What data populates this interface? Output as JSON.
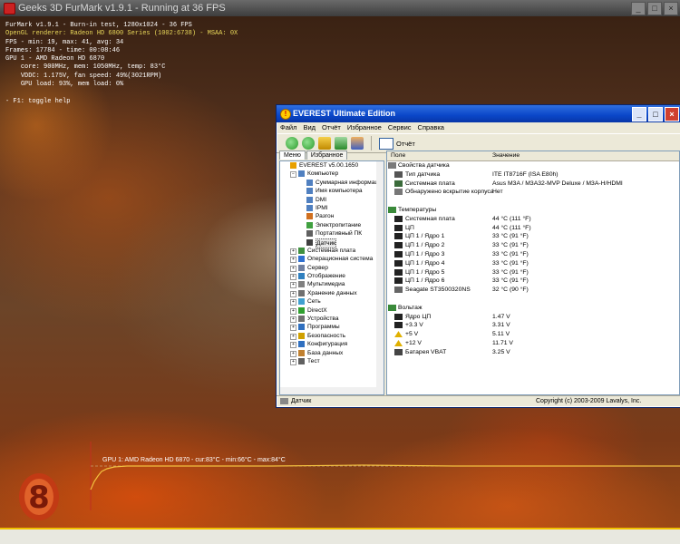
{
  "furmark": {
    "window_title": "Geeks 3D FurMark v1.9.1 - Running at 36 FPS",
    "osd": {
      "line1": "FurMark v1.9.1 - Burn-in test, 1280x1024 - 36 FPS",
      "line2": "OpenGL renderer: Radeon HD 6800 Series (1002:6738) - MSAA: 0X",
      "line3": "FPS - min: 19, max: 41, avg: 34",
      "line4": "Frames: 17784 - time: 00:08:46",
      "line5": "GPU 1 - AMD Radeon HD 6870",
      "line6": "core: 900MHz, mem: 1050MHz, temp: 83°C",
      "line7": "VDDC: 1.175V, fan speed: 49%(3021RPM)",
      "line8": "GPU load: 93%, mem load: 0%",
      "line9": "- F1: toggle help"
    },
    "graph_label": "GPU 1: AMD Radeon HD 6870 - cur:83°C - min:66°C - max:84°C",
    "logo_char": "8"
  },
  "everest": {
    "window_title": "EVEREST Ultimate Edition",
    "menu": [
      "Файл",
      "Вид",
      "Отчёт",
      "Избранное",
      "Сервис",
      "Справка"
    ],
    "report_label": "Отчёт",
    "tabs": [
      "Меню",
      "Избранное"
    ],
    "tree": [
      {
        "label": "EVEREST v5.00.1650",
        "depth": 0,
        "pm": "",
        "icon": "everest-icon",
        "color": "#e8a000"
      },
      {
        "label": "Компьютер",
        "depth": 1,
        "pm": "−",
        "icon": "computer-icon",
        "color": "#5080c0"
      },
      {
        "label": "Суммарная информация",
        "depth": 2,
        "pm": "",
        "icon": "summary-icon",
        "color": "#5080c0"
      },
      {
        "label": "Имя компьютера",
        "depth": 2,
        "pm": "",
        "icon": "computer-name-icon",
        "color": "#5080c0"
      },
      {
        "label": "DMI",
        "depth": 2,
        "pm": "",
        "icon": "dmi-icon",
        "color": "#5080c0"
      },
      {
        "label": "IPMI",
        "depth": 2,
        "pm": "",
        "icon": "ipmi-icon",
        "color": "#5080c0"
      },
      {
        "label": "Разгон",
        "depth": 2,
        "pm": "",
        "icon": "overclock-icon",
        "color": "#d07020"
      },
      {
        "label": "Электропитание",
        "depth": 2,
        "pm": "",
        "icon": "power-icon",
        "color": "#40a040"
      },
      {
        "label": "Портативный ПК",
        "depth": 2,
        "pm": "",
        "icon": "laptop-icon",
        "color": "#606060"
      },
      {
        "label": "Датчик",
        "depth": 2,
        "pm": "",
        "icon": "sensor-icon",
        "color": "#404040",
        "selected": true
      },
      {
        "label": "Системная плата",
        "depth": 1,
        "pm": "+",
        "icon": "motherboard-icon",
        "color": "#409040"
      },
      {
        "label": "Операционная система",
        "depth": 1,
        "pm": "+",
        "icon": "os-icon",
        "color": "#3070d0"
      },
      {
        "label": "Сервер",
        "depth": 1,
        "pm": "+",
        "icon": "server-icon",
        "color": "#7080a0"
      },
      {
        "label": "Отображение",
        "depth": 1,
        "pm": "+",
        "icon": "display-icon",
        "color": "#3080c0"
      },
      {
        "label": "Мультимедиа",
        "depth": 1,
        "pm": "+",
        "icon": "multimedia-icon",
        "color": "#808080"
      },
      {
        "label": "Хранение данных",
        "depth": 1,
        "pm": "+",
        "icon": "storage-icon",
        "color": "#707070"
      },
      {
        "label": "Сеть",
        "depth": 1,
        "pm": "+",
        "icon": "network-icon",
        "color": "#40a0d0"
      },
      {
        "label": "DirectX",
        "depth": 1,
        "pm": "+",
        "icon": "directx-icon",
        "color": "#30a030"
      },
      {
        "label": "Устройства",
        "depth": 1,
        "pm": "+",
        "icon": "devices-icon",
        "color": "#707070"
      },
      {
        "label": "Программы",
        "depth": 1,
        "pm": "+",
        "icon": "programs-icon",
        "color": "#3070c0"
      },
      {
        "label": "Безопасность",
        "depth": 1,
        "pm": "+",
        "icon": "security-icon",
        "color": "#d0a000"
      },
      {
        "label": "Конфигурация",
        "depth": 1,
        "pm": "+",
        "icon": "config-icon",
        "color": "#3070c0"
      },
      {
        "label": "База данных",
        "depth": 1,
        "pm": "+",
        "icon": "database-icon",
        "color": "#c08030"
      },
      {
        "label": "Тест",
        "depth": 1,
        "pm": "+",
        "icon": "test-icon",
        "color": "#606060"
      }
    ],
    "columns": {
      "field": "Поле",
      "value": "Значение"
    },
    "rows": [
      {
        "type": "section",
        "field": "Свойства датчика",
        "value": "",
        "icon": "sensor-properties-icon"
      },
      {
        "type": "item",
        "field": "Тип датчика",
        "value": "ITE IT8716F  (ISA E80h)",
        "icon": "chip-icon"
      },
      {
        "type": "item",
        "field": "Системная плата",
        "value": "Asus M3A / M3A32-MVP Deluxe / M3A-H/HDMI",
        "icon": "board-icon"
      },
      {
        "type": "item",
        "field": "Обнаружено вскрытие корпуса",
        "value": "Нет",
        "icon": "case-icon"
      },
      {
        "type": "blank",
        "field": "",
        "value": "",
        "icon": ""
      },
      {
        "type": "section",
        "field": "Температуры",
        "value": "",
        "icon": "thermometer-icon"
      },
      {
        "type": "item",
        "field": "Системная плата",
        "value": "44 °C  (111 °F)",
        "icon": "temp-sensor-icon"
      },
      {
        "type": "item",
        "field": "ЦП",
        "value": "44 °C  (111 °F)",
        "icon": "temp-sensor-icon"
      },
      {
        "type": "item",
        "field": "ЦП 1 / Ядро 1",
        "value": "33 °C  (91 °F)",
        "icon": "temp-sensor-icon"
      },
      {
        "type": "item",
        "field": "ЦП 1 / Ядро 2",
        "value": "33 °C  (91 °F)",
        "icon": "temp-sensor-icon"
      },
      {
        "type": "item",
        "field": "ЦП 1 / Ядро 3",
        "value": "33 °C  (91 °F)",
        "icon": "temp-sensor-icon"
      },
      {
        "type": "item",
        "field": "ЦП 1 / Ядро 4",
        "value": "33 °C  (91 °F)",
        "icon": "temp-sensor-icon"
      },
      {
        "type": "item",
        "field": "ЦП 1 / Ядро 5",
        "value": "33 °C  (91 °F)",
        "icon": "temp-sensor-icon"
      },
      {
        "type": "item",
        "field": "ЦП 1 / Ядро 6",
        "value": "33 °C  (91 °F)",
        "icon": "temp-sensor-icon"
      },
      {
        "type": "item",
        "field": "Seagate ST3500320NS",
        "value": "32 °C  (90 °F)",
        "icon": "hdd-icon"
      },
      {
        "type": "blank",
        "field": "",
        "value": "",
        "icon": ""
      },
      {
        "type": "section",
        "field": "Вольтаж",
        "value": "",
        "icon": "voltage-icon"
      },
      {
        "type": "item",
        "field": "Ядро ЦП",
        "value": "1.47 V",
        "icon": "volt-sensor-icon"
      },
      {
        "type": "item",
        "field": "+3.3 V",
        "value": "3.31 V",
        "icon": "volt-sensor-icon"
      },
      {
        "type": "item",
        "field": "+5 V",
        "value": "5.11 V",
        "icon": "warning-icon"
      },
      {
        "type": "item",
        "field": "+12 V",
        "value": "11.71 V",
        "icon": "warning-icon"
      },
      {
        "type": "item",
        "field": "Батарея VBAT",
        "value": "3.25 V",
        "icon": "battery-icon"
      }
    ],
    "status_left": "Датчик",
    "status_right": "Copyright (c) 2003-2009 Lavalys, Inc."
  }
}
